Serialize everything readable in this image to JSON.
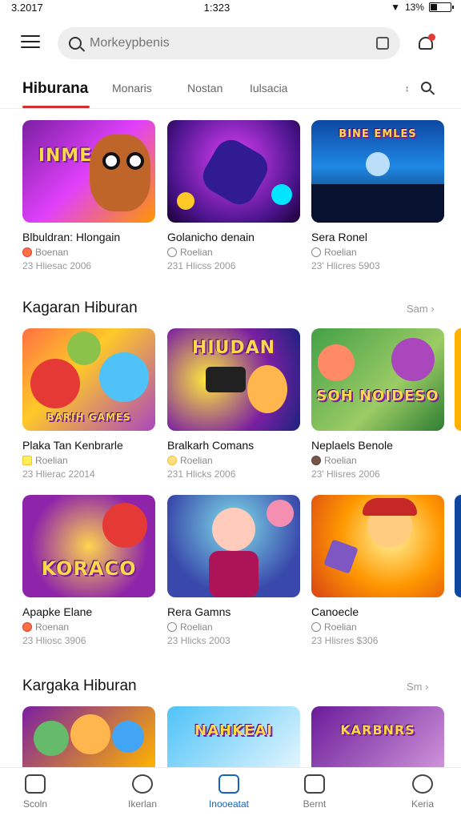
{
  "status": {
    "left": "3.2017",
    "time": "1:323",
    "battery": "13%",
    "battery_level": 0.3
  },
  "search": {
    "placeholder": "Morkeypbenis"
  },
  "tabs": [
    {
      "label": "Hiburana"
    },
    {
      "label": "Monaris"
    },
    {
      "label": "Nostan"
    },
    {
      "label": "Iulsacia"
    }
  ],
  "tabs_more": "↕",
  "row1": [
    {
      "title": "Blbuldran: Hlongain",
      "sub": "Boenan",
      "meta": "23 Hliesac 2006",
      "art": "INMEG"
    },
    {
      "title": "Golanicho denain",
      "sub": "Roelian",
      "meta": "231 Hlicss 2006",
      "art": ""
    },
    {
      "title": "Sera Ronel",
      "sub": "Roelian",
      "meta": "23' Hlicres 5903",
      "art": "BINE EMLES"
    }
  ],
  "section2": {
    "title": "Kagaran Hiburan",
    "see_all": "Sam ›"
  },
  "row2": [
    {
      "title": "Plaka Tan Kenbrarle",
      "sub": "Roelian",
      "meta": "23 Hlierac 22014",
      "art": "BARIH GAMES"
    },
    {
      "title": "Bralkarh Comans",
      "sub": "Roelian",
      "meta": "231 Hlicks 2006",
      "art": "HIUDAN"
    },
    {
      "title": "Neplaels Benole",
      "sub": "Roelian",
      "meta": "23' Hlisres 2006",
      "art": "SOH NOIDESO"
    }
  ],
  "row3": [
    {
      "title": "Apapke Elane",
      "sub": "Roenan",
      "meta": "23 Hliosc 3906",
      "art": "KORACO"
    },
    {
      "title": "Rera Gamns",
      "sub": "Roelian",
      "meta": "23 Hlicks 2003",
      "art": ""
    },
    {
      "title": "Canoecle",
      "sub": "Roelian",
      "meta": "23 Hlisres $306",
      "art": ""
    }
  ],
  "section3": {
    "title": "Kargaka Hiburan",
    "see_all": "Sm ›"
  },
  "row4": [
    {
      "art": ""
    },
    {
      "art": "NAHKEAI"
    },
    {
      "art": "KARBNRS"
    }
  ],
  "bottom_nav": [
    {
      "label": "Scoln"
    },
    {
      "label": "Ikerlan"
    },
    {
      "label": "Inooeatat"
    },
    {
      "label": "Bernt"
    },
    {
      "label": "Keria"
    }
  ],
  "colors": {
    "accent_red": "#d32f2f",
    "active_blue": "#1565c0"
  }
}
